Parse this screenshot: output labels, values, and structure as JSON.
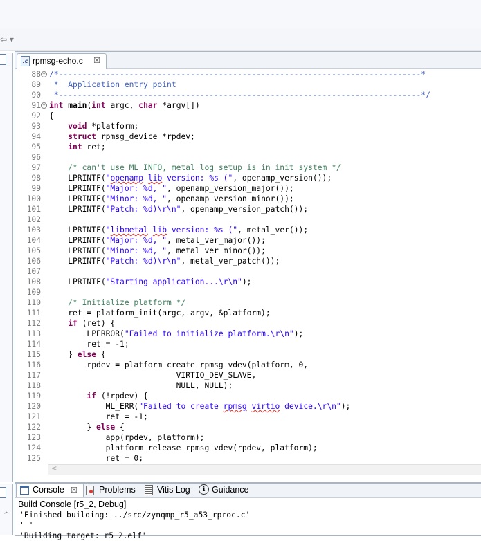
{
  "editor": {
    "tab": {
      "filename": "rpmsg-echo.c",
      "icon": "c-source-file-icon",
      "close": "☒"
    },
    "lines": [
      {
        "n": "88",
        "fold": true,
        "tokens": [
          [
            "cmb",
            "/*-----------------------------------------------------------------------------*"
          ]
        ]
      },
      {
        "n": "89",
        "tokens": [
          [
            "cmb",
            " *  Application entry point"
          ]
        ]
      },
      {
        "n": "90",
        "tokens": [
          [
            "cmb",
            " *-----------------------------------------------------------------------------*/"
          ]
        ]
      },
      {
        "n": "91",
        "fold": true,
        "tokens": [
          [
            "kw",
            "int"
          ],
          [
            "",
            " "
          ],
          [
            "b",
            "main"
          ],
          [
            "",
            "("
          ],
          [
            "kw",
            "int"
          ],
          [
            "",
            " argc, "
          ],
          [
            "kw",
            "char"
          ],
          [
            "",
            " *argv[])"
          ]
        ]
      },
      {
        "n": "92",
        "tokens": [
          [
            "",
            "{"
          ]
        ]
      },
      {
        "n": "93",
        "tokens": [
          [
            "",
            "    "
          ],
          [
            "kw",
            "void"
          ],
          [
            "",
            " *platform;"
          ]
        ]
      },
      {
        "n": "94",
        "tokens": [
          [
            "",
            "    "
          ],
          [
            "kw",
            "struct"
          ],
          [
            "",
            " rpmsg_device *rpdev;"
          ]
        ]
      },
      {
        "n": "95",
        "tokens": [
          [
            "",
            "    "
          ],
          [
            "kw",
            "int"
          ],
          [
            "",
            " ret;"
          ]
        ]
      },
      {
        "n": "96",
        "tokens": []
      },
      {
        "n": "97",
        "tokens": [
          [
            "",
            "    "
          ],
          [
            "cm",
            "/* can't use ML_INFO, metal_log setup is in init_system */"
          ]
        ]
      },
      {
        "n": "98",
        "tokens": [
          [
            "",
            "    LPRINTF("
          ],
          [
            "str",
            "\""
          ],
          [
            "strsq",
            "openamp"
          ],
          [
            "str",
            " "
          ],
          [
            "strsq",
            "lib"
          ],
          [
            "str",
            " version: %s (\""
          ],
          [
            "",
            ", openamp_version());"
          ]
        ]
      },
      {
        "n": "99",
        "tokens": [
          [
            "",
            "    LPRINTF("
          ],
          [
            "str",
            "\"Major: %d, \""
          ],
          [
            "",
            ", openamp_version_major());"
          ]
        ]
      },
      {
        "n": "100",
        "tokens": [
          [
            "",
            "    LPRINTF("
          ],
          [
            "str",
            "\"Minor: %d, \""
          ],
          [
            "",
            ", openamp_version_minor());"
          ]
        ]
      },
      {
        "n": "101",
        "tokens": [
          [
            "",
            "    LPRINTF("
          ],
          [
            "str",
            "\"Patch: %d)\\r\\n\""
          ],
          [
            "",
            ", openamp_version_patch());"
          ]
        ]
      },
      {
        "n": "102",
        "tokens": []
      },
      {
        "n": "103",
        "tokens": [
          [
            "",
            "    LPRINTF("
          ],
          [
            "str",
            "\""
          ],
          [
            "strsq",
            "libmetal"
          ],
          [
            "str",
            " "
          ],
          [
            "strsq",
            "lib"
          ],
          [
            "str",
            " version: %s (\""
          ],
          [
            "",
            ", metal_ver());"
          ]
        ]
      },
      {
        "n": "104",
        "tokens": [
          [
            "",
            "    LPRINTF("
          ],
          [
            "str",
            "\"Major: %d, \""
          ],
          [
            "",
            ", metal_ver_major());"
          ]
        ]
      },
      {
        "n": "105",
        "tokens": [
          [
            "",
            "    LPRINTF("
          ],
          [
            "str",
            "\"Minor: %d, \""
          ],
          [
            "",
            ", metal_ver_minor());"
          ]
        ]
      },
      {
        "n": "106",
        "tokens": [
          [
            "",
            "    LPRINTF("
          ],
          [
            "str",
            "\"Patch: %d)\\r\\n\""
          ],
          [
            "",
            ", metal_ver_patch());"
          ]
        ]
      },
      {
        "n": "107",
        "tokens": []
      },
      {
        "n": "108",
        "tokens": [
          [
            "",
            "    LPRINTF("
          ],
          [
            "str",
            "\"Starting application...\\r\\n\""
          ],
          [
            "",
            ");"
          ]
        ]
      },
      {
        "n": "109",
        "tokens": []
      },
      {
        "n": "110",
        "tokens": [
          [
            "",
            "    "
          ],
          [
            "cm",
            "/* Initialize platform */"
          ]
        ]
      },
      {
        "n": "111",
        "tokens": [
          [
            "",
            "    ret = platform_init(argc, argv, &platform);"
          ]
        ]
      },
      {
        "n": "112",
        "tokens": [
          [
            "",
            "    "
          ],
          [
            "kw",
            "if"
          ],
          [
            "",
            " (ret) {"
          ]
        ]
      },
      {
        "n": "113",
        "tokens": [
          [
            "",
            "        LPERROR("
          ],
          [
            "str",
            "\"Failed to initialize platform.\\r\\n\""
          ],
          [
            "",
            ");"
          ]
        ]
      },
      {
        "n": "114",
        "tokens": [
          [
            "",
            "        ret = -1;"
          ]
        ]
      },
      {
        "n": "115",
        "tokens": [
          [
            "",
            "    } "
          ],
          [
            "kw",
            "else"
          ],
          [
            "",
            " {"
          ]
        ]
      },
      {
        "n": "116",
        "tokens": [
          [
            "",
            "        rpdev = platform_create_rpmsg_vdev(platform, 0,"
          ]
        ]
      },
      {
        "n": "117",
        "tokens": [
          [
            "",
            "                           VIRTIO_DEV_SLAVE,"
          ]
        ]
      },
      {
        "n": "118",
        "tokens": [
          [
            "",
            "                           NULL, NULL);"
          ]
        ]
      },
      {
        "n": "119",
        "tokens": [
          [
            "",
            "        "
          ],
          [
            "kw",
            "if"
          ],
          [
            "",
            " (!rpdev) {"
          ]
        ]
      },
      {
        "n": "120",
        "tokens": [
          [
            "",
            "            ML_ERR("
          ],
          [
            "str",
            "\"Failed to create "
          ],
          [
            "strsq",
            "rpmsg"
          ],
          [
            "str",
            " "
          ],
          [
            "strsq",
            "virtio"
          ],
          [
            "str",
            " device.\\r\\n\""
          ],
          [
            "",
            ");"
          ]
        ]
      },
      {
        "n": "121",
        "tokens": [
          [
            "",
            "            ret = -1;"
          ]
        ]
      },
      {
        "n": "122",
        "tokens": [
          [
            "",
            "        } "
          ],
          [
            "kw",
            "else"
          ],
          [
            "",
            " {"
          ]
        ]
      },
      {
        "n": "123",
        "tokens": [
          [
            "",
            "            app(rpdev, platform);"
          ]
        ]
      },
      {
        "n": "124",
        "tokens": [
          [
            "",
            "            platform_release_rpmsg_vdev(rpdev, platform);"
          ]
        ]
      },
      {
        "n": "125",
        "tokens": [
          [
            "",
            "            ret = 0;"
          ]
        ]
      }
    ],
    "hscroll_arrow": "<"
  },
  "toolbar": {
    "nav": "⇦ ▾"
  },
  "bottom_panel": {
    "tabs": [
      {
        "label": "Console",
        "icon": "console-icon",
        "active": true,
        "close": "☒"
      },
      {
        "label": "Problems",
        "icon": "problems-icon"
      },
      {
        "label": "Vitis Log",
        "icon": "vitis-log-icon"
      },
      {
        "label": "Guidance",
        "icon": "guidance-icon",
        "glyph": "i"
      }
    ],
    "console_title": "Build Console [r5_2, Debug]",
    "scroll_arrow": "^",
    "output": [
      "'Finished building: ../src/zynqmp_r5_a53_rproc.c'",
      "' '",
      "'Building target: r5_2.elf'"
    ]
  }
}
